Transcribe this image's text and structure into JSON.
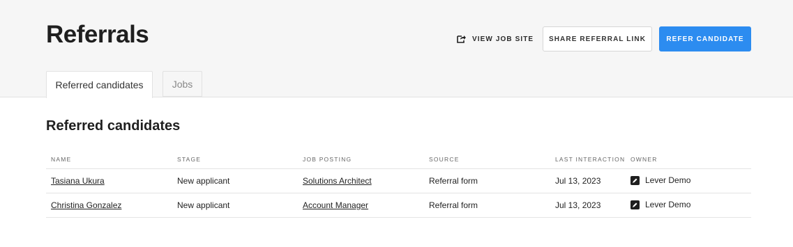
{
  "header": {
    "title": "Referrals",
    "view_job_site_label": "VIEW JOB SITE",
    "share_referral_link_label": "SHARE REFERRAL LINK",
    "refer_candidate_label": "REFER CANDIDATE",
    "accent_color": "#2c8cf0"
  },
  "tabs": [
    {
      "label": "Referred candidates",
      "active": true
    },
    {
      "label": "Jobs",
      "active": false
    }
  ],
  "section": {
    "title": "Referred candidates"
  },
  "table": {
    "columns": [
      "NAME",
      "STAGE",
      "JOB POSTING",
      "SOURCE",
      "LAST INTERACTION",
      "OWNER"
    ],
    "rows": [
      {
        "name": "Tasiana Ukura",
        "stage": "New applicant",
        "job_posting": "Solutions Architect",
        "source": "Referral form",
        "last_interaction": "Jul 13, 2023",
        "owner": "Lever Demo"
      },
      {
        "name": "Christina Gonzalez",
        "stage": "New applicant",
        "job_posting": "Account Manager",
        "source": "Referral form",
        "last_interaction": "Jul 13, 2023",
        "owner": "Lever Demo"
      }
    ]
  },
  "icons": {
    "view_job_site": "external-link-icon",
    "owner": "owner-avatar-icon"
  }
}
